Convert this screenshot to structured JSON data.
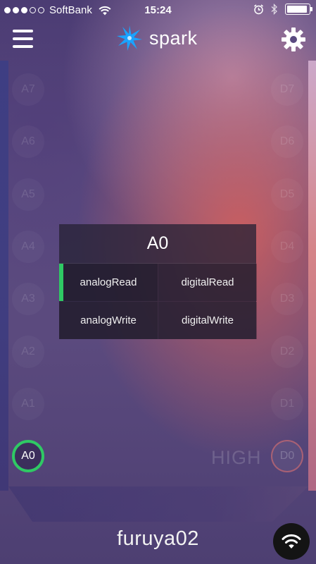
{
  "status_bar": {
    "signal_dots_filled": 3,
    "signal_dots_total": 5,
    "carrier": "SoftBank",
    "time": "15:24",
    "battery_level": 0.95,
    "icons": [
      "wifi-icon",
      "alarm-icon",
      "bluetooth-icon",
      "battery-icon"
    ]
  },
  "nav": {
    "app_name": "spark",
    "icons": [
      "menu-icon",
      "spark-logo-icon",
      "settings-gear-icon"
    ]
  },
  "pins": {
    "left": [
      "A7",
      "A6",
      "A5",
      "A4",
      "A3",
      "A2",
      "A1",
      "A0"
    ],
    "right": [
      "D7",
      "D6",
      "D5",
      "D4",
      "D3",
      "D2",
      "D1",
      "D0"
    ],
    "active_pin": "A0",
    "d0_state": "HIGH"
  },
  "pin_menu": {
    "title": "A0",
    "options": [
      "analogRead",
      "digitalRead",
      "analogWrite",
      "digitalWrite"
    ],
    "selected": "analogRead"
  },
  "footer": {
    "device_name": "furuya02",
    "connect_icon": "wifi-icon"
  },
  "colors": {
    "active": "#2fc964",
    "accent_blue": "#1aa3ff"
  }
}
